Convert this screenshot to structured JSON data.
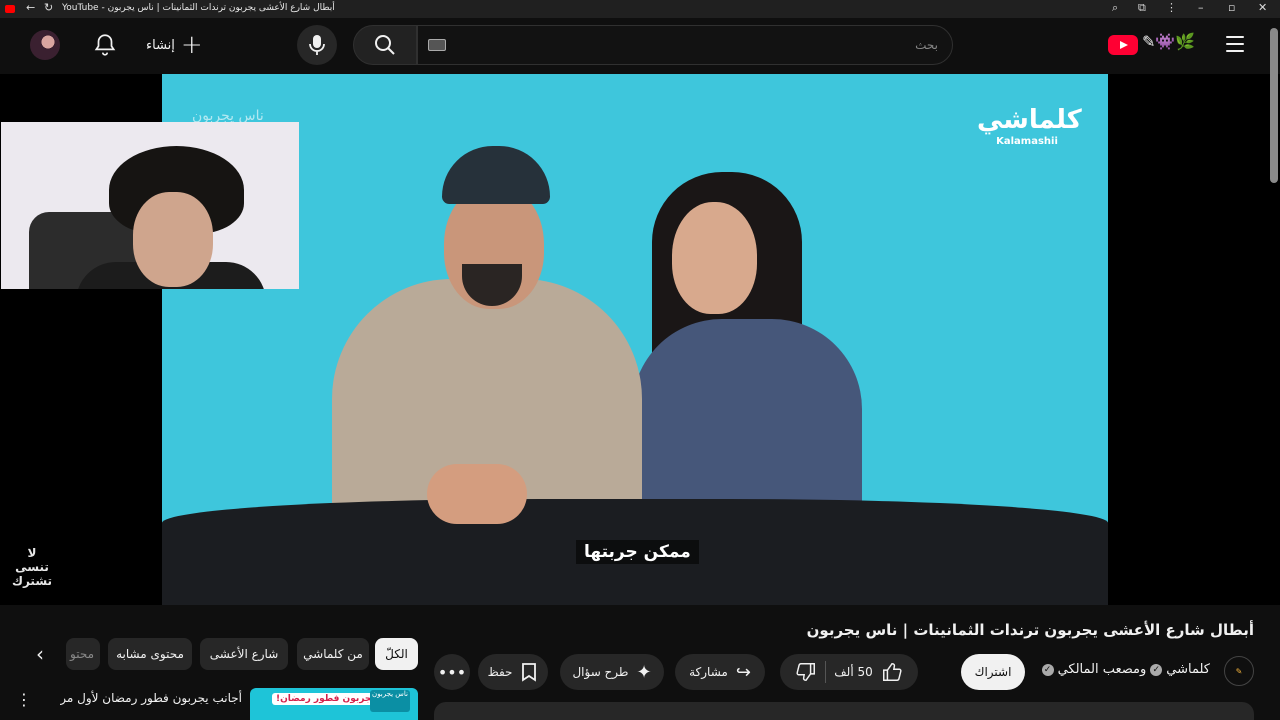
{
  "window": {
    "title": "YouTube - أبطال شارع الأعشى يجربون ترندات الثمانينات | ناس يجربون"
  },
  "header": {
    "create_label": "إنشاء",
    "search_placeholder": "بحث"
  },
  "player": {
    "brand_ar": "كلماشي",
    "brand_en": "Kalamashii",
    "overlay_top": "ناس يجربون",
    "subtitle": "ممكن جربتها",
    "side_reminder": "لا تنسى تشترك"
  },
  "video": {
    "title": "أبطال شارع الأعشى يجربون ترندات الثمانينات | ناس يجربون",
    "channel_1": "كلماشي",
    "channel_2": "ومصعب المالكي",
    "subscribe_label": "اشتراك",
    "likes": "50 ألف",
    "share_label": "مشاركة",
    "ask_label": "طرح سؤال",
    "save_label": "حفظ"
  },
  "chips": {
    "all": "الكلّ",
    "from_channel": "من كلماشي",
    "street": "شارع الأعشى",
    "similar": "محتوى مشابه",
    "cut": "محتو"
  },
  "recommendation": {
    "thumb_banner": "أجانب يجربون فطور رمضان!",
    "thumb_logo": "ناس يجربون",
    "title": "أجانب يجربون فطور رمضان لأول مرة! | ناس يجربون"
  }
}
